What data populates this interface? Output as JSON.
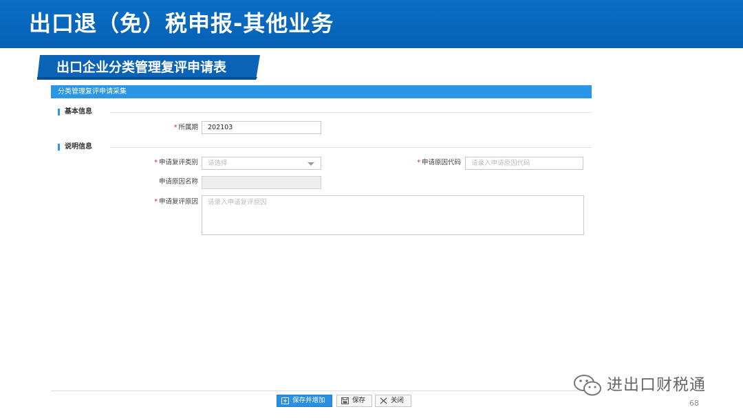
{
  "slide": {
    "title": "出口退（免）税申报-其他业务",
    "section_tag": "出口企业分类管理复评申请表",
    "page_number": "68"
  },
  "form": {
    "header": "分类管理复评申请采集",
    "group_basic": "基本信息",
    "group_desc": "说明信息",
    "period": {
      "required_mark": "*",
      "label": "所属期",
      "value": "202103"
    },
    "review_type": {
      "required_mark": "*",
      "label": "申请复评类别",
      "placeholder": "请选择"
    },
    "reason_code": {
      "required_mark": "*",
      "label": "申请原因代码",
      "placeholder": "请录入申请原因代码"
    },
    "reason_name": {
      "label": "申请原因名称",
      "value": ""
    },
    "review_reason": {
      "required_mark": "*",
      "label": "申请复评原因",
      "placeholder": "请录入申请复评原因"
    }
  },
  "buttons": {
    "save_and_add": "保存并增加",
    "save": "保存",
    "close": "关闭"
  },
  "watermark": {
    "text": "进出口财税通"
  },
  "colors": {
    "banner": "#0560b4",
    "form_header": "#2a96e6",
    "required": "#e02020",
    "primary_button": "#2a8fe0"
  }
}
